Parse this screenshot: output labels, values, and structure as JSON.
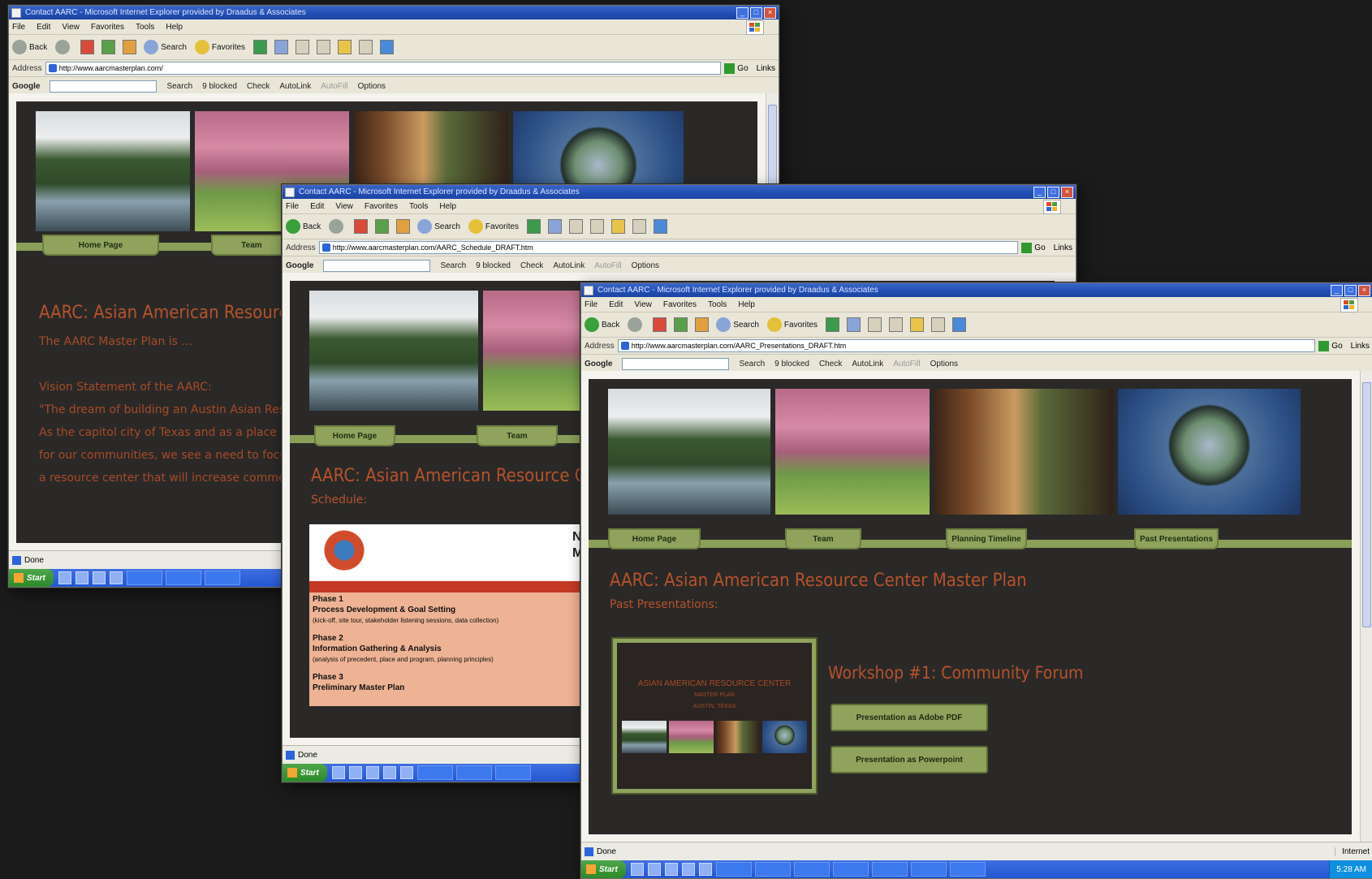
{
  "windows": [
    {
      "title": "Contact AARC - Microsoft Internet Explorer provided by Draadus & Associates",
      "url": "http://www.aarcmasterplan.com/",
      "tabs": [
        "Home Page",
        "Team"
      ],
      "heading": "AARC: Asian American Resource Ce",
      "lines": [
        "The AARC Master Plan is ...",
        "",
        "Vision Statement of the AARC:",
        "\"The dream of building an Austin Asian Resource",
        "  As the capitol city of Texas and as a place wher",
        "  for our communities, we see a need to focus on",
        "  a resource center that will increase commerce c"
      ]
    },
    {
      "title": "Contact AARC - Microsoft Internet Explorer provided by Draadus & Associates",
      "url": "http://www.aarcmasterplan.com/AARC_Schedule_DRAFT.htm",
      "tabs": [
        "Home Page",
        "Team"
      ],
      "heading": "AARC: Asian American Resource Cente",
      "subheading": "Schedule:",
      "schedule_letters": [
        "Na",
        "M"
      ],
      "phases": [
        {
          "title": "Phase 1",
          "name": "Process Development & Goal Setting",
          "detail": "(kick-off, site tour, stakeholder listening sessions, data collection)"
        },
        {
          "title": "Phase 2",
          "name": "Information Gathering & Analysis",
          "detail": "(analysis of precedent, place and program, planning principles)"
        },
        {
          "title": "Phase 3",
          "name": "Preliminary Master Plan",
          "detail": ""
        }
      ]
    },
    {
      "title": "Contact AARC - Microsoft Internet Explorer provided by Draadus & Associates",
      "url": "http://www.aarcmasterplan.com/AARC_Presentations_DRAFT.htm",
      "tabs": [
        "Home Page",
        "Team",
        "Planning Timeline",
        "Past Presentations"
      ],
      "heading": "AARC: Asian American Resource Center Master Plan",
      "subheading": "Past Presentations:",
      "thumb_title": "ASIAN AMERICAN RESOURCE CENTER",
      "thumb_sub1": "MASTER PLAN",
      "thumb_sub2": "AUSTIN, TEXAS",
      "workshop": "Workshop #1: Community Forum",
      "buttons": [
        "Presentation as Adobe PDF",
        "Presentation as Powerpoint"
      ]
    }
  ],
  "browser": {
    "menu": [
      "File",
      "Edit",
      "View",
      "Favorites",
      "Tools",
      "Help"
    ],
    "back": "Back",
    "search": "Search",
    "favorites": "Favorites",
    "address_label": "Address",
    "go": "Go",
    "links": "Links",
    "google": "Google",
    "google_search": "Search",
    "blocked": "9 blocked",
    "check": "Check",
    "autolink": "AutoLink",
    "autofill": "AutoFill",
    "options": "Options",
    "status": "Done",
    "zone": "Internet",
    "start": "Start",
    "clock": "5:28 AM"
  }
}
